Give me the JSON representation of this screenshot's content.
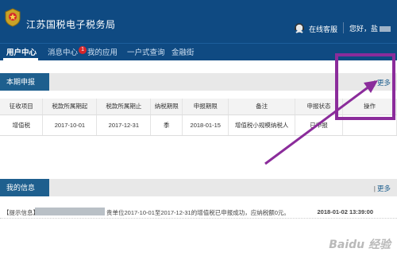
{
  "header": {
    "title": "江苏国税电子税务局",
    "online_service": "在线客服",
    "greeting": "您好，盐"
  },
  "nav": {
    "items": [
      "用户中心",
      "消息中心",
      "我的应用",
      "一户式查询",
      "金融街"
    ],
    "badge": "1"
  },
  "declare_section": {
    "title": "本期申报",
    "more": "更多",
    "columns": [
      "征收项目",
      "税款所属期起",
      "税款所属期止",
      "纳税期限",
      "申报期限",
      "备注",
      "申报状态",
      "操作"
    ],
    "rows": [
      [
        "增值税",
        "2017-10-01",
        "2017-12-31",
        "季",
        "2018-01-15",
        "增值税小规模纳税人",
        "已申报",
        ""
      ]
    ]
  },
  "info_section": {
    "title": "我的信息",
    "more": "更多",
    "notice_label": "【提示信息】盐",
    "notice_text": "贵单位2017-10-01至2017-12-31的增值税已申报成功，应纳税额0元。",
    "notice_time": "2018-01-02 13:39:00"
  },
  "watermark": "Baidu 经验",
  "colors": {
    "header_bg": "#0f4a82",
    "section_tab": "#1e5f8e",
    "annotation": "#8b2c9b",
    "badge": "#d6262b"
  }
}
